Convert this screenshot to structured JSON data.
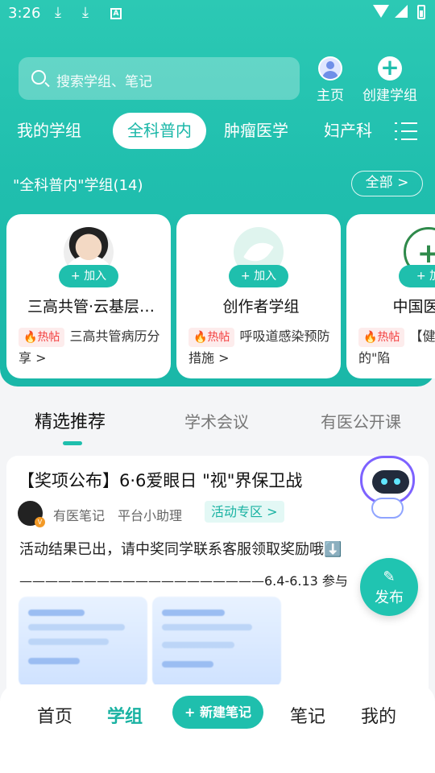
{
  "status_bar": {
    "time": "3:26",
    "download_icon": "download-icon",
    "a_icon": "A"
  },
  "search": {
    "placeholder": "搜索学组、笔记"
  },
  "top_actions": {
    "home_label": "主页",
    "create_label": "创建学组"
  },
  "category_tabs": [
    "我的学组",
    "全科普内",
    "肿瘤医学",
    "妇产科"
  ],
  "group_section": {
    "title": "\"全科普内\"学组(14)",
    "all_label": "全部 >"
  },
  "groups": [
    {
      "name": "三高共管·云基层…",
      "join": "+ 加入",
      "hot": "热帖",
      "post": "三高共管病历分享 >"
    },
    {
      "name": "创作者学组",
      "join": "+ 加入",
      "hot": "热帖",
      "post": "呼吸道感染预防措施 >"
    },
    {
      "name": "中国医药教",
      "join": "+ 加",
      "hot": "热帖",
      "post": "【健静脉输液的\"陷"
    }
  ],
  "section_tabs": [
    "精选推荐",
    "学术会议",
    "有医公开课"
  ],
  "post": {
    "title": "【奖项公布】6·6爱眼日 \"视\"界保卫战",
    "author": "有医笔记",
    "subtitle": "平台小助理",
    "tag": "活动专区 >",
    "body_line1": "活动结果已出，请中奖同学联系客服领取奖励哦⬇️",
    "body_line2": "———————————————————6.4-6.13 参与"
  },
  "publish": {
    "label": "发布"
  },
  "bottom_nav": {
    "home": "首页",
    "groups": "学组",
    "new_note": "+ 新建笔记",
    "notes": "笔记",
    "mine": "我的"
  },
  "colors": {
    "accent": "#1fbfad",
    "hot": "#f34040"
  }
}
